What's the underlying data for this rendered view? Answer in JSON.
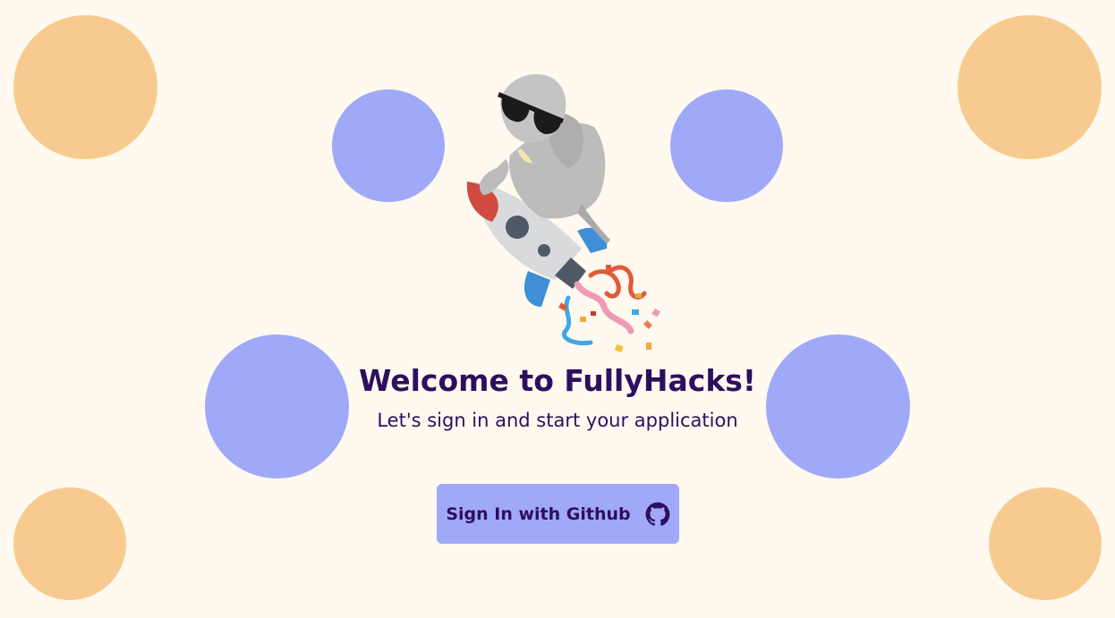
{
  "title": "Welcome to FullyHacks!",
  "subtitle": "Let's sign in and start your application",
  "signin": {
    "label": "Sign In with Github",
    "icon": "github-icon"
  },
  "decorations": {
    "mascot": "elephant-on-rocket",
    "colors": {
      "background": "#fff9ef",
      "orange_circle": "#f7cb8f",
      "purple_circle": "#a0a9f8",
      "text": "#2d0f5e"
    }
  }
}
